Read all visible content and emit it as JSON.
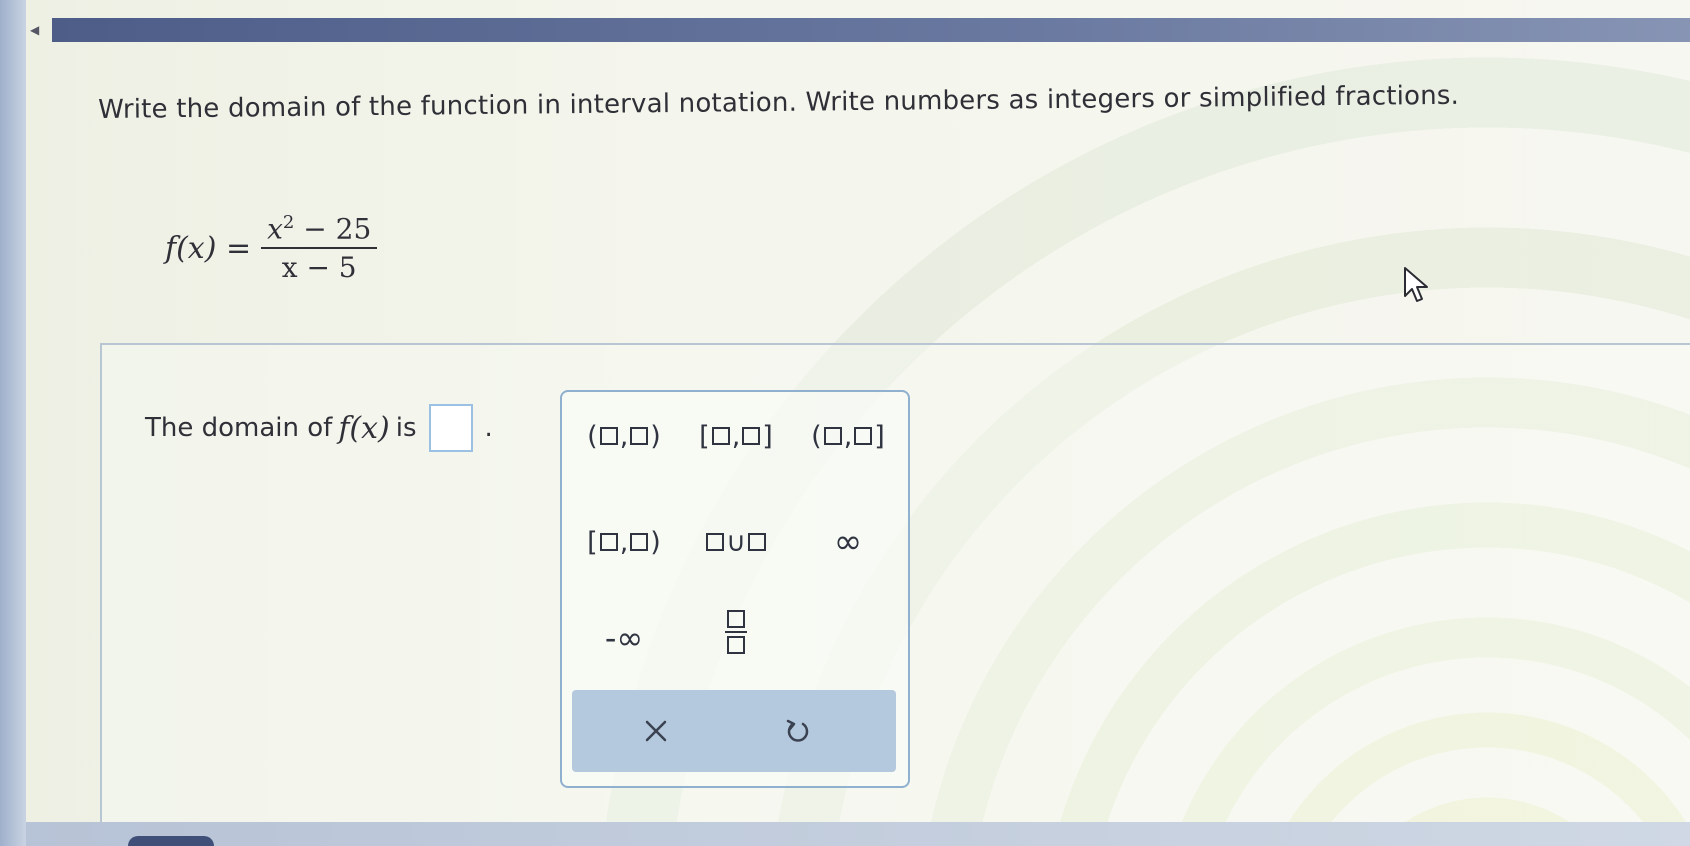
{
  "question": {
    "instructions": "Write the domain of the function in interval notation. Write numbers as integers or simplified fractions.",
    "function_lhs": "f(x) =",
    "numerator_base": "x",
    "numerator_exp": "2",
    "numerator_rest": "− 25",
    "denominator": "x − 5"
  },
  "answer": {
    "prefix": "The domain of",
    "func": "f(x)",
    "is": "is",
    "value": "",
    "period": "."
  },
  "palette": {
    "buttons": [
      {
        "id": "open-open",
        "left": "(",
        "right": ")"
      },
      {
        "id": "closed-closed",
        "left": "[",
        "right": "]"
      },
      {
        "id": "open-closed",
        "left": "(",
        "right": "]"
      },
      {
        "id": "closed-open",
        "left": "[",
        "right": ")"
      }
    ],
    "union_symbol": "∪",
    "infinity": "∞",
    "neg_infinity": "-∞",
    "comma": ","
  },
  "colors": {
    "accent_border": "#8fb0cf",
    "action_bar": "#b4c9dd",
    "top_bar": "#4d5d88"
  },
  "icons": {
    "clear": "close-icon",
    "undo": "undo-icon",
    "cursor": "mouse-pointer-icon"
  }
}
